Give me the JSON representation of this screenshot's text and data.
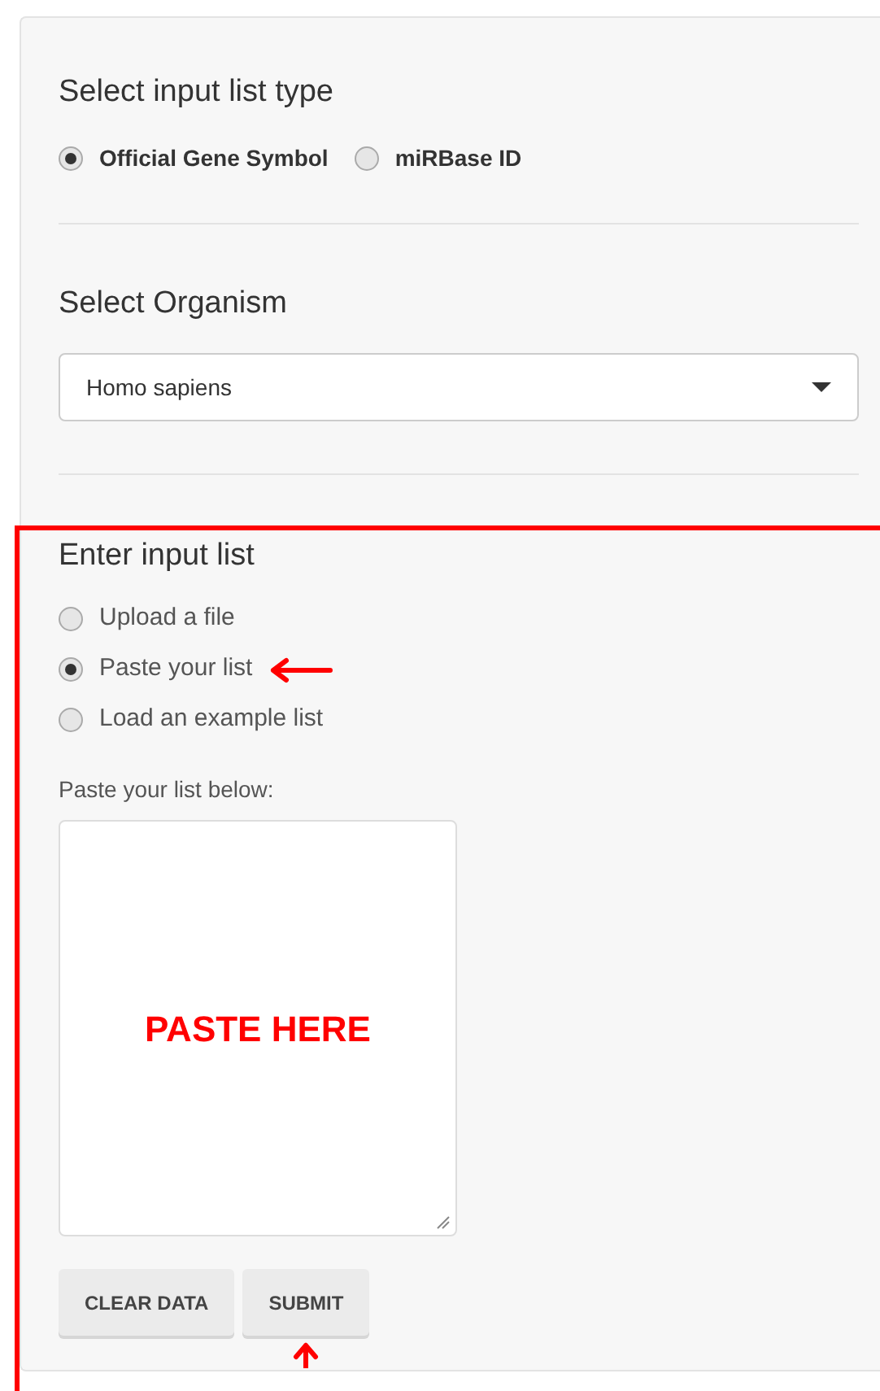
{
  "list_type": {
    "title": "Select input list type",
    "options": [
      {
        "label": "Official Gene Symbol",
        "selected": true
      },
      {
        "label": "miRBase ID",
        "selected": false
      }
    ]
  },
  "organism": {
    "title": "Select Organism",
    "value": "Homo sapiens"
  },
  "input_list": {
    "title": "Enter input list",
    "options": [
      {
        "label": "Upload a file",
        "selected": false
      },
      {
        "label": "Paste your list",
        "selected": true
      },
      {
        "label": "Load an example list",
        "selected": false
      }
    ],
    "paste_label": "Paste your list below:",
    "paste_hint": "PASTE HERE",
    "buttons": [
      "CLEAR DATA",
      "SUBMIT"
    ]
  }
}
